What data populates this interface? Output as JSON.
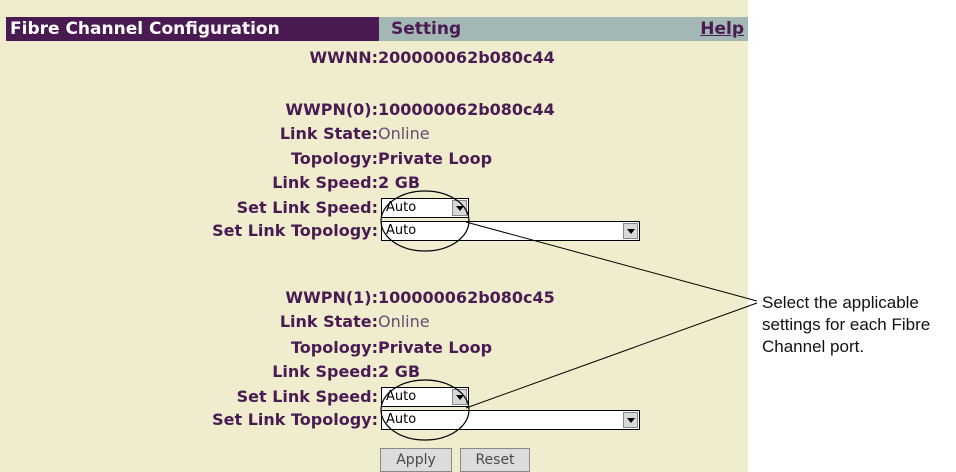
{
  "header": {
    "title": "Fibre Channel Configuration",
    "section": "Setting",
    "help": "Help"
  },
  "wwnn": {
    "label": "WWNN:",
    "value": "200000062b080c44"
  },
  "ports": [
    {
      "wwpn_label": "WWPN(0):",
      "wwpn": "100000062b080c44",
      "link_state_label": "Link State:",
      "link_state": "Online",
      "topology_label": "Topology:",
      "topology": "Private Loop",
      "link_speed_label": "Link Speed:",
      "link_speed": "2 GB",
      "set_speed_label": "Set Link Speed:",
      "set_speed": "Auto",
      "set_topology_label": "Set Link Topology:",
      "set_topology": "Auto"
    },
    {
      "wwpn_label": "WWPN(1):",
      "wwpn": "100000062b080c45",
      "link_state_label": "Link State:",
      "link_state": "Online",
      "topology_label": "Topology:",
      "topology": "Private Loop",
      "link_speed_label": "Link Speed:",
      "link_speed": "2 GB",
      "set_speed_label": "Set Link Speed:",
      "set_speed": "Auto",
      "set_topology_label": "Set Link Topology:",
      "set_topology": "Auto"
    }
  ],
  "buttons": {
    "apply": "Apply",
    "reset": "Reset"
  },
  "callout": "Select the applicable settings for each Fibre Channel port.",
  "colors": {
    "header_dark": "#4a1a52",
    "header_light": "#a3b7b4",
    "background": "#efedce"
  }
}
